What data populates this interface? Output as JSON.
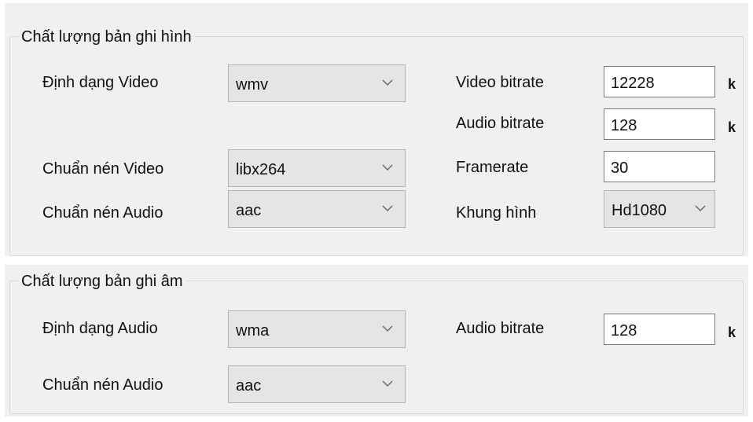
{
  "video": {
    "title": "Chất lượng bản ghi hình",
    "format_label": "Định dạng Video",
    "format_value": "wmv",
    "video_codec_label": "Chuẩn nén Video",
    "video_codec_value": "libx264",
    "audio_codec_label": "Chuẩn nén Audio",
    "audio_codec_value": "aac",
    "video_bitrate_label": "Video bitrate",
    "video_bitrate_value": "12228",
    "video_bitrate_unit": "k",
    "audio_bitrate_label": "Audio bitrate",
    "audio_bitrate_value": "128",
    "audio_bitrate_unit": "k",
    "framerate_label": "Framerate",
    "framerate_value": "30",
    "frame_label": "Khung hình",
    "frame_value": "Hd1080"
  },
  "audio": {
    "title": "Chất lượng bản ghi âm",
    "format_label": "Định dạng Audio",
    "format_value": "wma",
    "audio_codec_label": "Chuẩn nén Audio",
    "audio_codec_value": "aac",
    "audio_bitrate_label": "Audio bitrate",
    "audio_bitrate_value": "128",
    "audio_bitrate_unit": "k"
  },
  "icons": {
    "dropdown": "chevron-down-icon"
  }
}
